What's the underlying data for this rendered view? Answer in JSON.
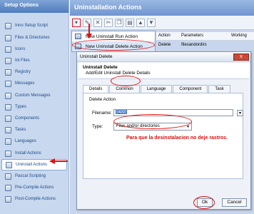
{
  "sidebar": {
    "title": "Setup Options",
    "items": [
      {
        "label": "Inno Setup Script"
      },
      {
        "label": "Files & Directories"
      },
      {
        "label": "Icons"
      },
      {
        "label": "Ini Files"
      },
      {
        "label": "Registry"
      },
      {
        "label": "Messages"
      },
      {
        "label": "Custom Messages"
      },
      {
        "label": "Types"
      },
      {
        "label": "Components"
      },
      {
        "label": "Tasks"
      },
      {
        "label": "Languages"
      },
      {
        "label": "Install Actions"
      },
      {
        "label": "Uninstall Actions"
      },
      {
        "label": "Pascal Scripting"
      },
      {
        "label": "Pre-Compile Actions"
      },
      {
        "label": "Post-Compile Actions"
      }
    ],
    "selected": "Uninstall Actions"
  },
  "main": {
    "title": "Uninstallation Actions",
    "menu": [
      {
        "label": "New Uninstall Run Action"
      },
      {
        "label": "New Uninstall Delete Action"
      }
    ],
    "columns": [
      "Action",
      "Parameters",
      "Working"
    ],
    "row": {
      "action": "Delete",
      "parameters": "filesandordirs"
    }
  },
  "dialog": {
    "title": "Uninstall Delete",
    "close": "x",
    "heading": "Uninstall Delete",
    "subheading": "Add/Edit Uninstall Delete Details",
    "tabs": [
      "Details",
      "Common",
      "Language",
      "Component",
      "Task"
    ],
    "group_label": "Delete Action",
    "filename_label": "Filename:",
    "filename_value": "{app}",
    "type_label": "Type:",
    "type_value": "Files and/or directories",
    "ok": "Ok",
    "cancel": "Cancel"
  },
  "annotation": "Para que la desinstalacion no deje rastros.",
  "colors": {
    "annotation": "#d40d0d",
    "header": "#6f95cf"
  }
}
